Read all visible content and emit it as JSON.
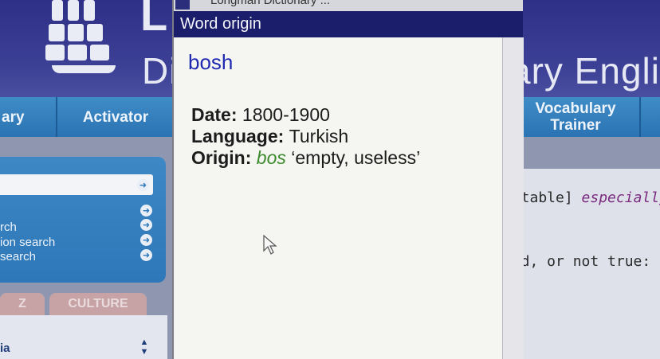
{
  "background_app": {
    "brand_letter": "L",
    "title_left": "Di",
    "title_right": "ary Engli",
    "tabs": {
      "left_partial": "ary",
      "activator": "Activator",
      "vocabulary_trainer": "Vocabulary Trainer"
    },
    "side_links": [
      "rch",
      "ion search",
      "search"
    ],
    "lower_tabs": [
      "Z",
      "CULTURE"
    ],
    "lower_item": "ia",
    "definition_line1_grammar": "untable]",
    "definition_line1_register": "especially",
    "definition_line2": "ood, or not true:"
  },
  "popup": {
    "window_title": "Longman Dictionary ...",
    "header": "Word origin",
    "headword": "bosh",
    "date_label": "Date:",
    "date_value": "1800-1900",
    "language_label": "Language:",
    "language_value": "Turkish",
    "origin_label": "Origin:",
    "origin_word": "bos",
    "origin_meaning": "‘empty, useless’"
  },
  "colors": {
    "popup_header": "#1b1e6b",
    "headword": "#1f2ab0",
    "origin_word": "#3c8a2c",
    "tab_bar": "#2b73b3"
  }
}
